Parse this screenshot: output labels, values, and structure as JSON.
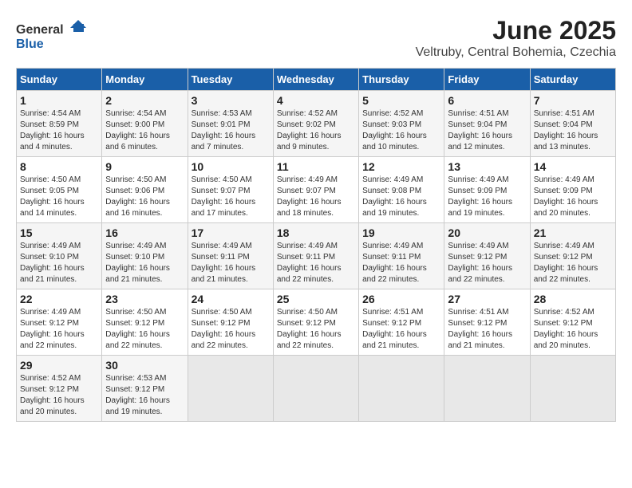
{
  "header": {
    "logo_general": "General",
    "logo_blue": "Blue",
    "title": "June 2025",
    "location": "Veltruby, Central Bohemia, Czechia"
  },
  "weekdays": [
    "Sunday",
    "Monday",
    "Tuesday",
    "Wednesday",
    "Thursday",
    "Friday",
    "Saturday"
  ],
  "weeks": [
    [
      {
        "day": "1",
        "sunrise": "4:54 AM",
        "sunset": "8:59 PM",
        "daylight": "16 hours and 4 minutes."
      },
      {
        "day": "2",
        "sunrise": "4:54 AM",
        "sunset": "9:00 PM",
        "daylight": "16 hours and 6 minutes."
      },
      {
        "day": "3",
        "sunrise": "4:53 AM",
        "sunset": "9:01 PM",
        "daylight": "16 hours and 7 minutes."
      },
      {
        "day": "4",
        "sunrise": "4:52 AM",
        "sunset": "9:02 PM",
        "daylight": "16 hours and 9 minutes."
      },
      {
        "day": "5",
        "sunrise": "4:52 AM",
        "sunset": "9:03 PM",
        "daylight": "16 hours and 10 minutes."
      },
      {
        "day": "6",
        "sunrise": "4:51 AM",
        "sunset": "9:04 PM",
        "daylight": "16 hours and 12 minutes."
      },
      {
        "day": "7",
        "sunrise": "4:51 AM",
        "sunset": "9:04 PM",
        "daylight": "16 hours and 13 minutes."
      }
    ],
    [
      {
        "day": "8",
        "sunrise": "4:50 AM",
        "sunset": "9:05 PM",
        "daylight": "16 hours and 14 minutes."
      },
      {
        "day": "9",
        "sunrise": "4:50 AM",
        "sunset": "9:06 PM",
        "daylight": "16 hours and 16 minutes."
      },
      {
        "day": "10",
        "sunrise": "4:50 AM",
        "sunset": "9:07 PM",
        "daylight": "16 hours and 17 minutes."
      },
      {
        "day": "11",
        "sunrise": "4:49 AM",
        "sunset": "9:07 PM",
        "daylight": "16 hours and 18 minutes."
      },
      {
        "day": "12",
        "sunrise": "4:49 AM",
        "sunset": "9:08 PM",
        "daylight": "16 hours and 19 minutes."
      },
      {
        "day": "13",
        "sunrise": "4:49 AM",
        "sunset": "9:09 PM",
        "daylight": "16 hours and 19 minutes."
      },
      {
        "day": "14",
        "sunrise": "4:49 AM",
        "sunset": "9:09 PM",
        "daylight": "16 hours and 20 minutes."
      }
    ],
    [
      {
        "day": "15",
        "sunrise": "4:49 AM",
        "sunset": "9:10 PM",
        "daylight": "16 hours and 21 minutes."
      },
      {
        "day": "16",
        "sunrise": "4:49 AM",
        "sunset": "9:10 PM",
        "daylight": "16 hours and 21 minutes."
      },
      {
        "day": "17",
        "sunrise": "4:49 AM",
        "sunset": "9:11 PM",
        "daylight": "16 hours and 21 minutes."
      },
      {
        "day": "18",
        "sunrise": "4:49 AM",
        "sunset": "9:11 PM",
        "daylight": "16 hours and 22 minutes."
      },
      {
        "day": "19",
        "sunrise": "4:49 AM",
        "sunset": "9:11 PM",
        "daylight": "16 hours and 22 minutes."
      },
      {
        "day": "20",
        "sunrise": "4:49 AM",
        "sunset": "9:12 PM",
        "daylight": "16 hours and 22 minutes."
      },
      {
        "day": "21",
        "sunrise": "4:49 AM",
        "sunset": "9:12 PM",
        "daylight": "16 hours and 22 minutes."
      }
    ],
    [
      {
        "day": "22",
        "sunrise": "4:49 AM",
        "sunset": "9:12 PM",
        "daylight": "16 hours and 22 minutes."
      },
      {
        "day": "23",
        "sunrise": "4:50 AM",
        "sunset": "9:12 PM",
        "daylight": "16 hours and 22 minutes."
      },
      {
        "day": "24",
        "sunrise": "4:50 AM",
        "sunset": "9:12 PM",
        "daylight": "16 hours and 22 minutes."
      },
      {
        "day": "25",
        "sunrise": "4:50 AM",
        "sunset": "9:12 PM",
        "daylight": "16 hours and 22 minutes."
      },
      {
        "day": "26",
        "sunrise": "4:51 AM",
        "sunset": "9:12 PM",
        "daylight": "16 hours and 21 minutes."
      },
      {
        "day": "27",
        "sunrise": "4:51 AM",
        "sunset": "9:12 PM",
        "daylight": "16 hours and 21 minutes."
      },
      {
        "day": "28",
        "sunrise": "4:52 AM",
        "sunset": "9:12 PM",
        "daylight": "16 hours and 20 minutes."
      }
    ],
    [
      {
        "day": "29",
        "sunrise": "4:52 AM",
        "sunset": "9:12 PM",
        "daylight": "16 hours and 20 minutes."
      },
      {
        "day": "30",
        "sunrise": "4:53 AM",
        "sunset": "9:12 PM",
        "daylight": "16 hours and 19 minutes."
      },
      null,
      null,
      null,
      null,
      null
    ]
  ]
}
